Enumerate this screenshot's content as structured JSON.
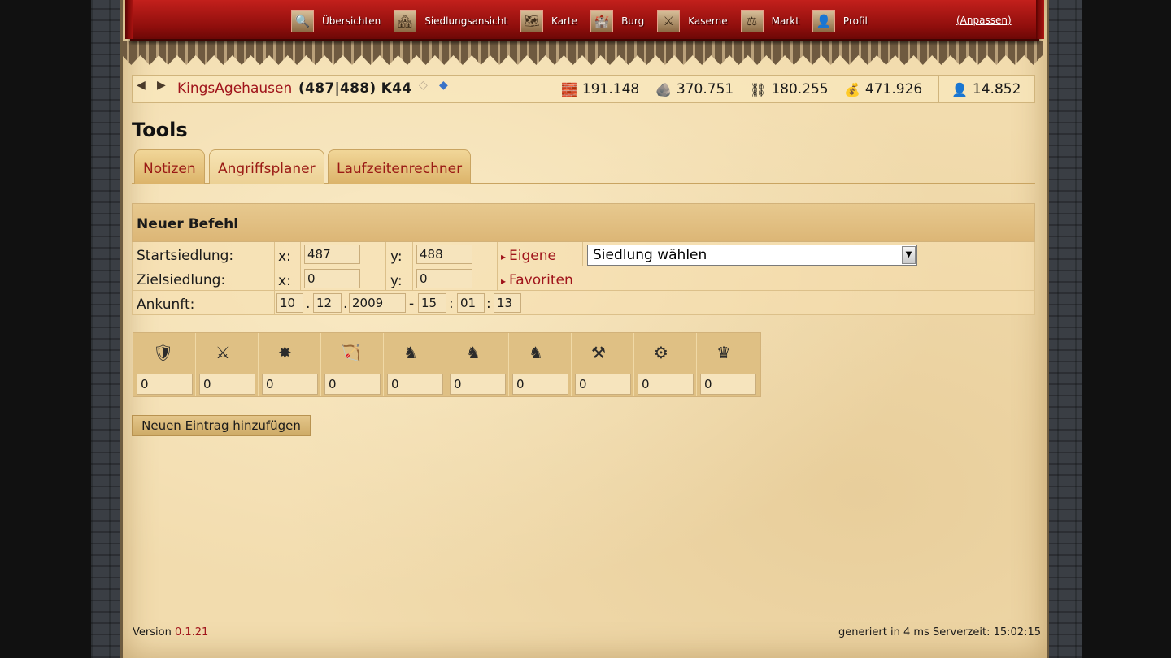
{
  "nav": {
    "items": [
      {
        "label": "Übersichten",
        "icon": "search-icon",
        "glyph": "🔍"
      },
      {
        "label": "Siedlungsansicht",
        "icon": "buildings-icon",
        "glyph": "🏘"
      },
      {
        "label": "Karte",
        "icon": "map-icon",
        "glyph": "🗺"
      },
      {
        "label": "Burg",
        "icon": "castle-icon",
        "glyph": "🏰"
      },
      {
        "label": "Kaserne",
        "icon": "barracks-icon",
        "glyph": "⚔"
      },
      {
        "label": "Markt",
        "icon": "market-icon",
        "glyph": "⚖"
      },
      {
        "label": "Profil",
        "icon": "profile-icon",
        "glyph": "👤"
      }
    ],
    "customize_label": "(Anpassen)"
  },
  "village": {
    "name": "KingsAgehausen",
    "coords": "(487|488) K44"
  },
  "resources": [
    {
      "name": "wood-icon",
      "glyph": "🧱",
      "value": "191.148"
    },
    {
      "name": "stone-icon",
      "glyph": "🪨",
      "value": "370.751"
    },
    {
      "name": "ore-icon",
      "glyph": "⛓",
      "value": "180.255"
    },
    {
      "name": "silver-icon",
      "glyph": "💰",
      "value": "471.926"
    },
    {
      "name": "population-icon",
      "glyph": "👤",
      "value": "14.852"
    }
  ],
  "page": {
    "title": "Tools",
    "tabs": [
      "Notizen",
      "Angriffsplaner",
      "Laufzeitenrechner"
    ],
    "active_tab": "Angriffsplaner"
  },
  "form": {
    "heading": "Neuer Befehl",
    "start_label": "Startsiedlung:",
    "target_label": "Zielsiedlung:",
    "arrival_label": "Ankunft:",
    "x_label": "x:",
    "y_label": "y:",
    "start_x": "487",
    "start_y": "488",
    "target_x": "0",
    "target_y": "0",
    "own_link": "Eigene",
    "favorites_link": "Favoriten",
    "select_value": "Siedlung wählen",
    "arrival": {
      "day": "10",
      "month": "12",
      "year": "2009",
      "hour": "15",
      "minute": "01",
      "second": "13",
      "sep_dot": ".",
      "sep_dash": "-",
      "sep_colon": ":"
    }
  },
  "units": [
    {
      "icon": "spearman-icon",
      "glyph": "🛡",
      "value": "0"
    },
    {
      "icon": "swordsman-icon",
      "glyph": "⚔",
      "value": "0"
    },
    {
      "icon": "axeman-icon",
      "glyph": "✸",
      "value": "0"
    },
    {
      "icon": "archer-icon",
      "glyph": "🏹",
      "value": "0"
    },
    {
      "icon": "scout-icon",
      "glyph": "♞",
      "value": "0"
    },
    {
      "icon": "light-cavalry-icon",
      "glyph": "♞",
      "value": "0"
    },
    {
      "icon": "heavy-cavalry-icon",
      "glyph": "♞",
      "value": "0"
    },
    {
      "icon": "ram-icon",
      "glyph": "⚒",
      "value": "0"
    },
    {
      "icon": "catapult-icon",
      "glyph": "⚙",
      "value": "0"
    },
    {
      "icon": "noble-icon",
      "glyph": "♛",
      "value": "0"
    }
  ],
  "add_button": "Neuen Eintrag hinzufügen",
  "footer": {
    "version_label": "Version",
    "version": "0.1.21",
    "generated": "generiert in 4 ms Serverzeit: 15:02:15"
  }
}
